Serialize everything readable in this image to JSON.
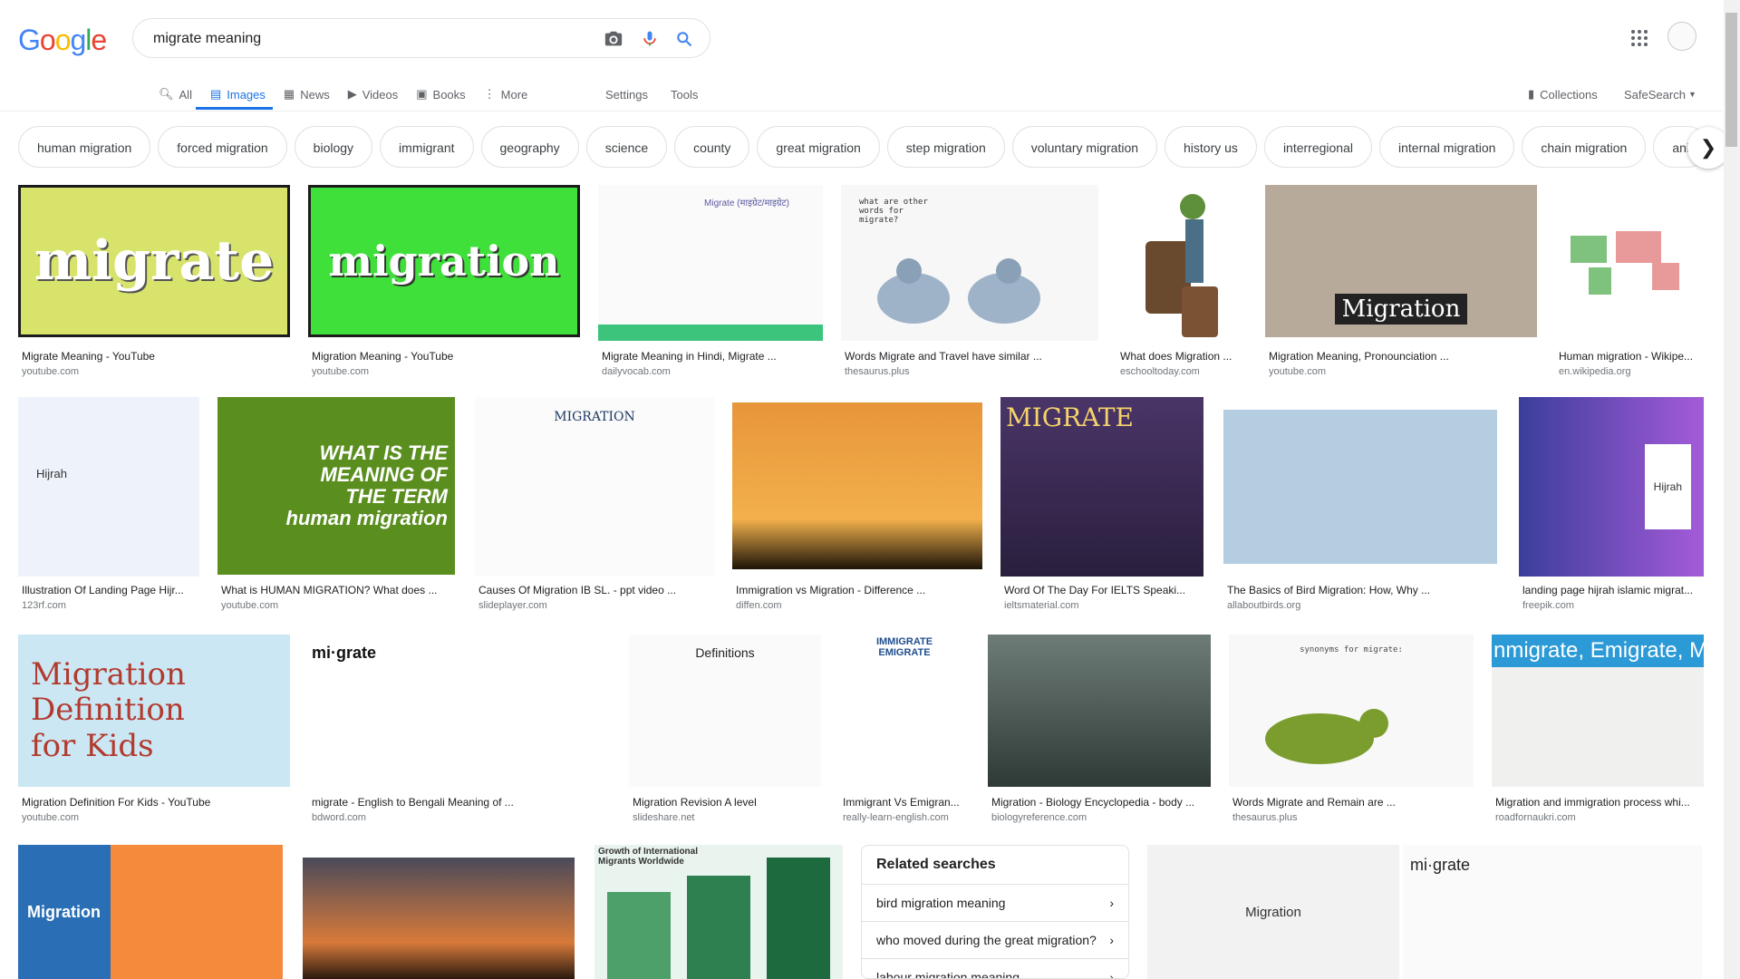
{
  "search": {
    "query": "migrate meaning"
  },
  "tabs": [
    {
      "label": "All",
      "icon": "search-icon"
    },
    {
      "label": "Images",
      "icon": "image-icon"
    },
    {
      "label": "News",
      "icon": "news-icon"
    },
    {
      "label": "Videos",
      "icon": "video-icon"
    },
    {
      "label": "Books",
      "icon": "book-icon"
    },
    {
      "label": "More",
      "icon": "more-vert-icon"
    }
  ],
  "tools": {
    "settings": "Settings",
    "tools": "Tools",
    "collections": "Collections",
    "safesearch": "SafeSearch"
  },
  "logo": {
    "text": "Google"
  },
  "chips": [
    "human migration",
    "forced migration",
    "biology",
    "immigrant",
    "geography",
    "science",
    "county",
    "great migration",
    "step migration",
    "voluntary migration",
    "history us",
    "interregional",
    "internal migration",
    "chain migration",
    "ani"
  ],
  "results": [
    {
      "title": "Migrate Meaning - YouTube",
      "source": "youtube.com",
      "img_text": "migrate"
    },
    {
      "title": "Migration Meaning - YouTube",
      "source": "youtube.com",
      "img_text": "migration"
    },
    {
      "title": "Migrate Meaning in Hindi, Migrate ...",
      "source": "dailyvocab.com",
      "img_text": "Migrate (माइग्रेट/माइग्रेट)"
    },
    {
      "title": "Words Migrate and Travel have similar ...",
      "source": "thesaurus.plus",
      "img_text": "what are other words for migrate?"
    },
    {
      "title": "What does Migration ...",
      "source": "eschooltoday.com",
      "img_text": ""
    },
    {
      "title": "Migration Meaning, Pronounciation ...",
      "source": "youtube.com",
      "img_text": "Migration"
    },
    {
      "title": "Human migration - Wikipe...",
      "source": "en.wikipedia.org",
      "img_text": ""
    },
    {
      "title": "Illustration Of Landing Page Hijr...",
      "source": "123rf.com",
      "img_text": "Hijrah"
    },
    {
      "title": "What is HUMAN MIGRATION? What does ...",
      "source": "youtube.com",
      "img_text": "WHAT IS THE MEANING OF THE TERM human migration"
    },
    {
      "title": "Causes Of Migration IB SL. - ppt video ...",
      "source": "slideplayer.com",
      "img_text": "MIGRATION"
    },
    {
      "title": "Immigration vs Migration - Difference ...",
      "source": "diffen.com",
      "img_text": ""
    },
    {
      "title": "Word Of The Day For IELTS Speaki...",
      "source": "ieltsmaterial.com",
      "img_text": "MIGRATE"
    },
    {
      "title": "The Basics of Bird Migration: How, Why ...",
      "source": "allaboutbirds.org",
      "img_text": ""
    },
    {
      "title": "landing page hijrah islamic migrat...",
      "source": "freepik.com",
      "img_text": "Hijrah"
    },
    {
      "title": "Migration Definition For Kids - YouTube",
      "source": "youtube.com",
      "img_text": "Migration Definition for Kids"
    },
    {
      "title": "migrate - English to Bengali Meaning of ...",
      "source": "bdword.com",
      "img_text": "mi·grate"
    },
    {
      "title": "Migration Revision A level",
      "source": "slideshare.net",
      "img_text": "Definitions"
    },
    {
      "title": "Immigrant Vs Emigran...",
      "source": "really-learn-english.com",
      "img_text": "IMMIGRATE EMIGRATE"
    },
    {
      "title": "Migration - Biology Encyclopedia - body ...",
      "source": "biologyreference.com",
      "img_text": ""
    },
    {
      "title": "Words Migrate and Remain are ...",
      "source": "thesaurus.plus",
      "img_text": "synonyms for migrate:"
    },
    {
      "title": "Migration and immigration process whi...",
      "source": "roadfornaukri.com",
      "img_text": "nmigrate, Emigrate, Mig"
    },
    {
      "title": "",
      "source": "",
      "img_text": "Migration"
    },
    {
      "title": "",
      "source": "",
      "img_text": ""
    },
    {
      "title": "",
      "source": "",
      "img_text": "Growth of International Migrants Worldwide"
    },
    {
      "title": "",
      "source": "",
      "img_text": "Migration"
    },
    {
      "title": "",
      "source": "",
      "img_text": "mi·grate"
    }
  ],
  "related": {
    "heading": "Related searches",
    "items": [
      "bird migration meaning",
      "who moved during the great migration?",
      "labour migration meaning"
    ]
  },
  "colors": {
    "accent": "#1a73e8",
    "text": "#202124",
    "muted": "#70757a"
  }
}
